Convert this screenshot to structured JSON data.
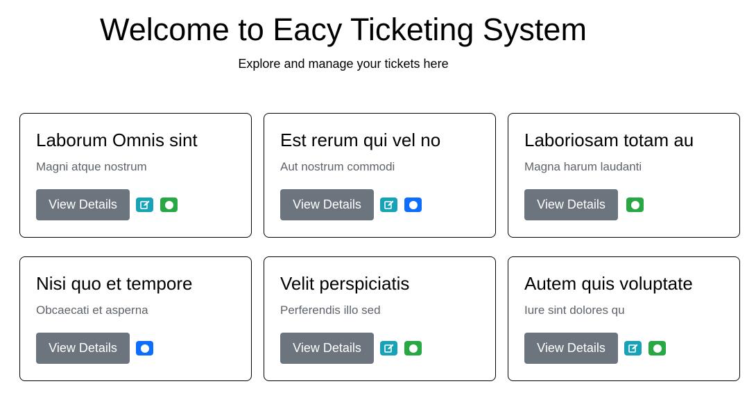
{
  "header": {
    "title": "Welcome to Eacy Ticketing System",
    "subtitle": "Explore and manage your tickets here"
  },
  "colors": {
    "view_button": "#6c757d",
    "edit_icon": "#17a2b8",
    "blue_icon": "#0d6efd",
    "green_icon": "#28a745"
  },
  "tickets": [
    {
      "title": "Laborum Omnis sint",
      "text": "Magni atque nostrum",
      "button_label": "View Details",
      "icons": [
        "edit-icon",
        "green-status-icon"
      ]
    },
    {
      "title": "Est rerum qui vel no",
      "text": "Aut nostrum commodi",
      "button_label": "View Details",
      "icons": [
        "edit-icon",
        "blue-status-icon"
      ]
    },
    {
      "title": "Laboriosam totam au",
      "text": "Magna harum laudanti",
      "button_label": "View Details",
      "icons": [
        "green-status-icon"
      ]
    },
    {
      "title": "Nisi quo et tempore",
      "text": "Obcaecati et asperna",
      "button_label": "View Details",
      "icons": [
        "blue-status-icon"
      ]
    },
    {
      "title": "Velit perspiciatis",
      "text": "Perferendis illo sed",
      "button_label": "View Details",
      "icons": [
        "edit-icon",
        "green-status-icon"
      ]
    },
    {
      "title": "Autem quis voluptate",
      "text": "Iure sint dolores qu",
      "button_label": "View Details",
      "icons": [
        "edit-icon",
        "green-status-icon"
      ]
    }
  ]
}
